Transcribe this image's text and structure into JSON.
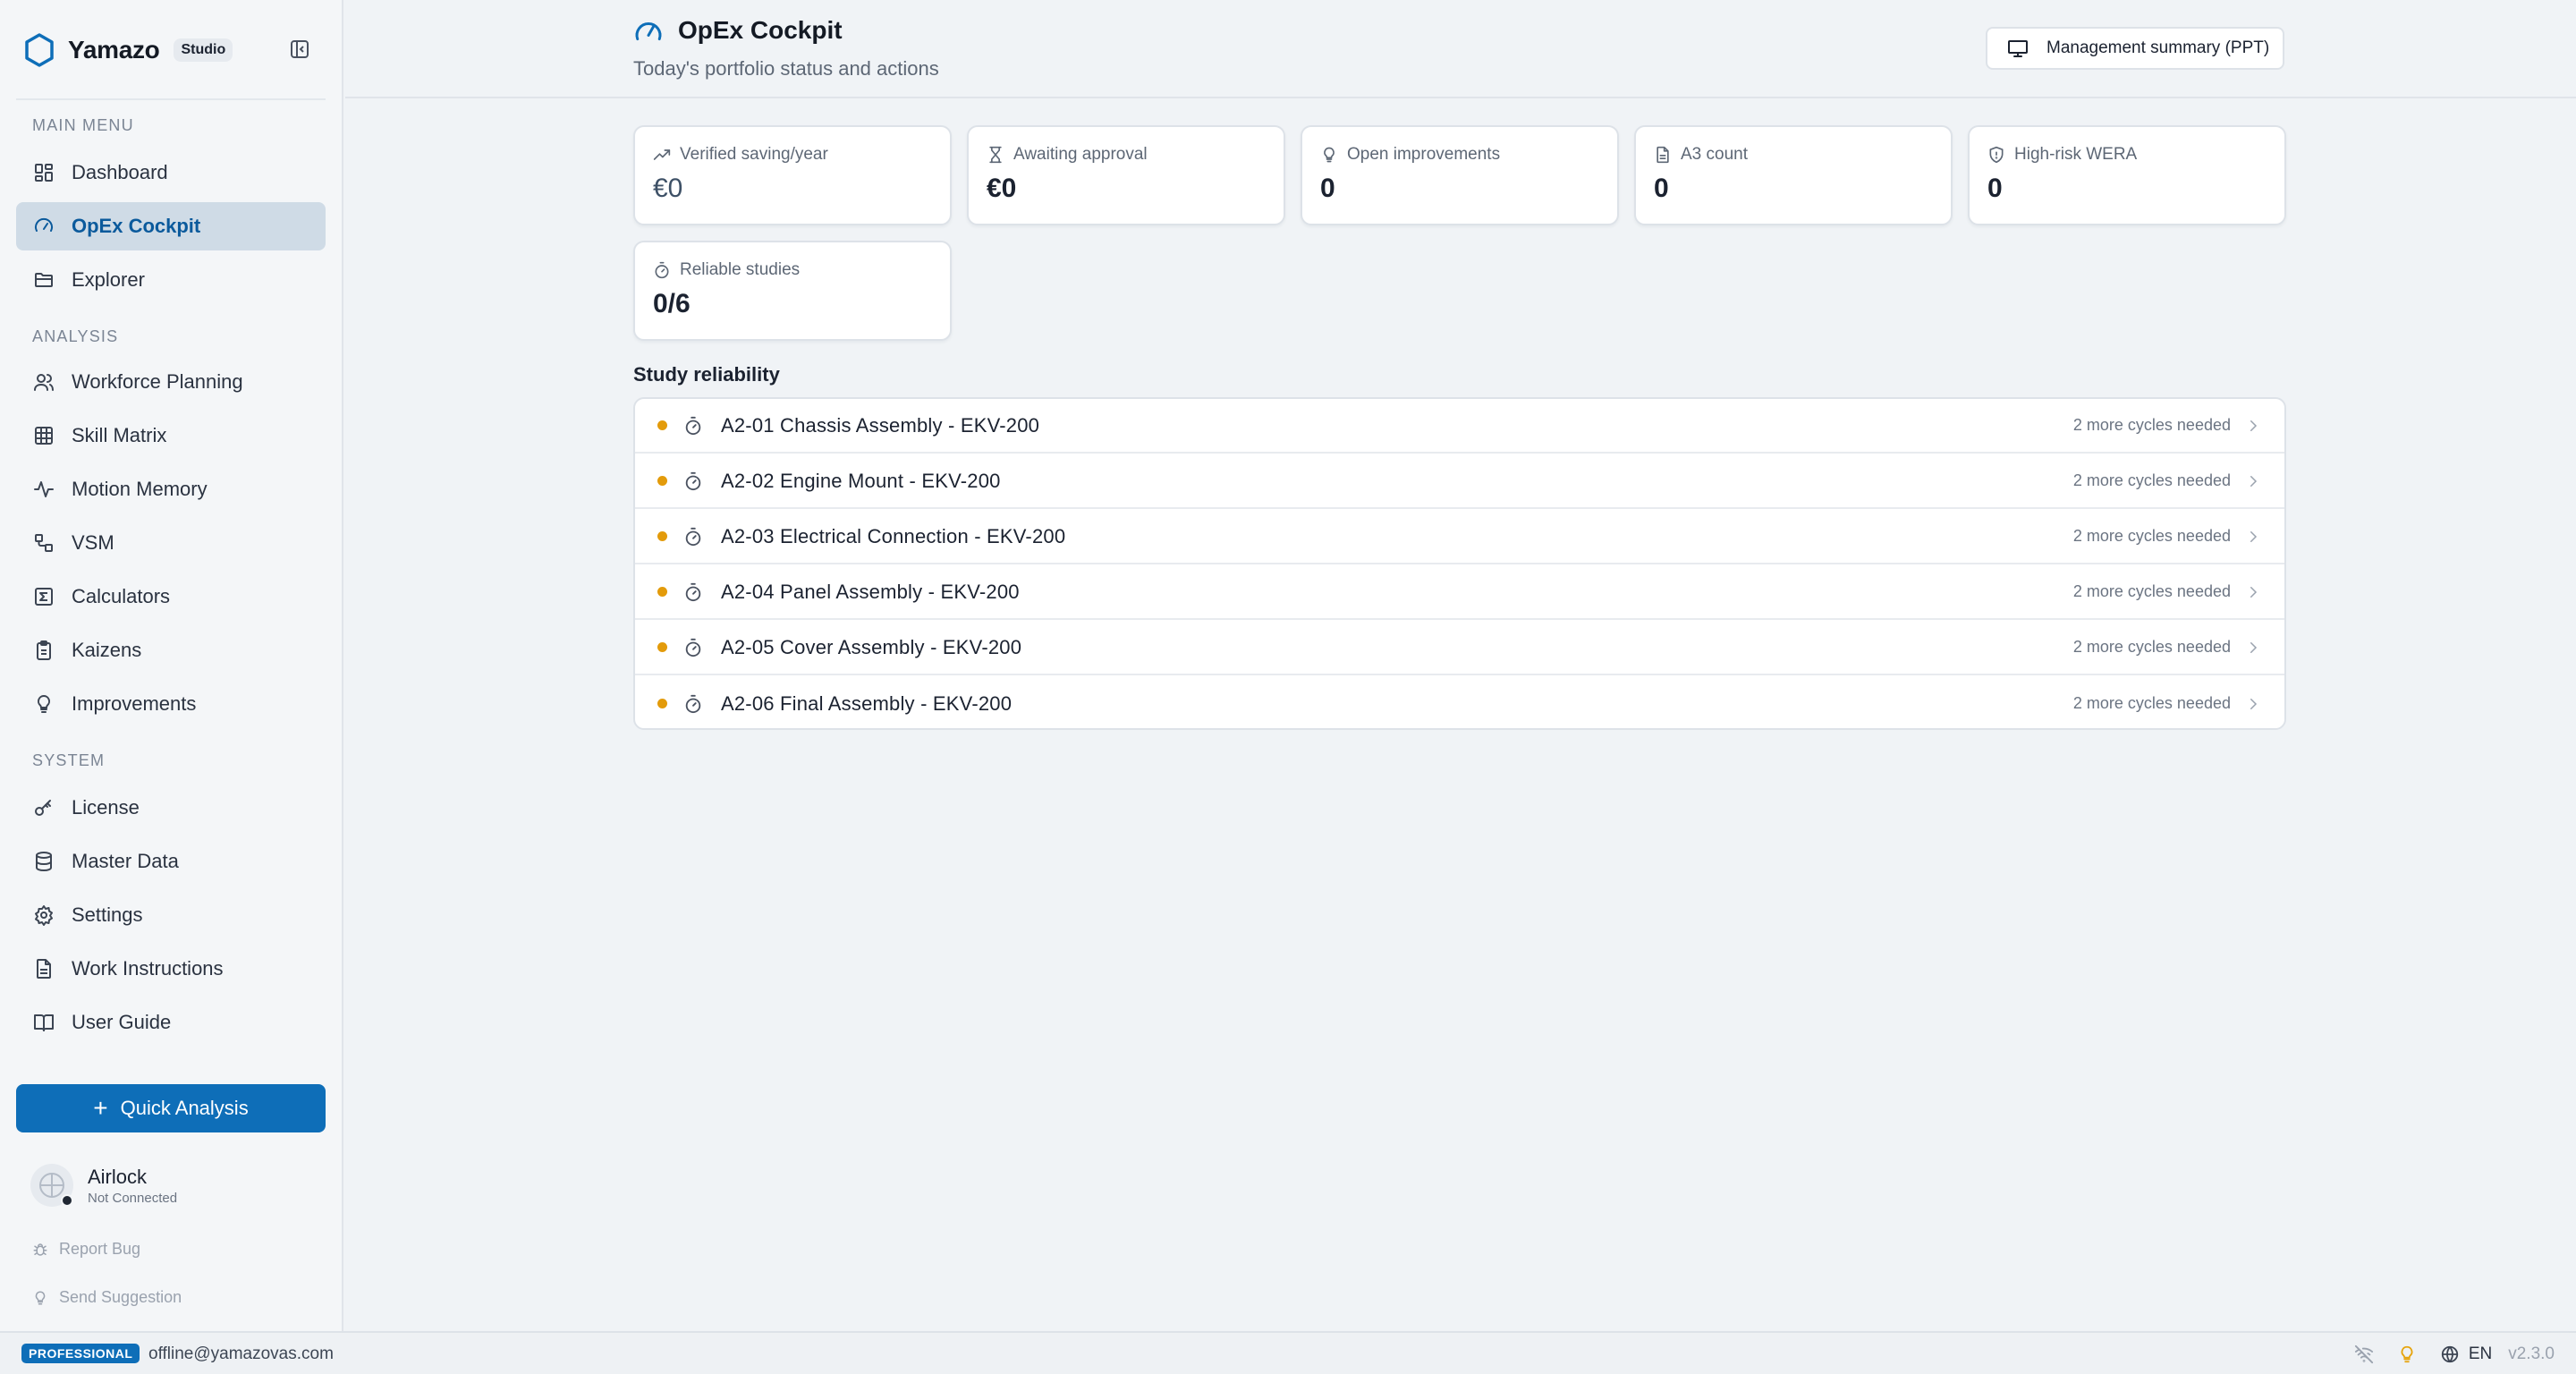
{
  "brand": {
    "name": "Yamazo",
    "badge": "Studio"
  },
  "sidebar": {
    "sections": {
      "main": "MAIN MENU",
      "analysis": "ANALYSIS",
      "system": "SYSTEM"
    },
    "main_items": [
      {
        "label": "Dashboard",
        "icon": "dashboard-icon"
      },
      {
        "label": "OpEx Cockpit",
        "icon": "gauge-icon",
        "active": true
      },
      {
        "label": "Explorer",
        "icon": "folder-icon"
      }
    ],
    "analysis_items": [
      {
        "label": "Workforce Planning",
        "icon": "users-icon"
      },
      {
        "label": "Skill Matrix",
        "icon": "grid-icon"
      },
      {
        "label": "Motion Memory",
        "icon": "activity-icon"
      },
      {
        "label": "VSM",
        "icon": "flow-icon"
      },
      {
        "label": "Calculators",
        "icon": "sigma-icon"
      },
      {
        "label": "Kaizens",
        "icon": "clipboard-icon"
      },
      {
        "label": "Improvements",
        "icon": "lightbulb-icon"
      }
    ],
    "system_items": [
      {
        "label": "License",
        "icon": "key-icon"
      },
      {
        "label": "Master Data",
        "icon": "database-icon"
      },
      {
        "label": "Settings",
        "icon": "gear-icon"
      },
      {
        "label": "Work Instructions",
        "icon": "document-icon"
      },
      {
        "label": "User Guide",
        "icon": "book-icon"
      }
    ],
    "quick_button": "Quick Analysis",
    "airlock": {
      "name": "Airlock",
      "status": "Not Connected"
    },
    "report_bug": "Report Bug",
    "send_suggestion": "Send Suggestion"
  },
  "header": {
    "title": "OpEx Cockpit",
    "subtitle": "Today's portfolio status and actions",
    "ppt_button": "Management summary (PPT)"
  },
  "kpis": [
    {
      "label": "Verified saving/year",
      "value": "€0",
      "icon": "trend-up-icon"
    },
    {
      "label": "Awaiting approval",
      "value": "€0",
      "icon": "hourglass-icon"
    },
    {
      "label": "Open improvements",
      "value": "0",
      "icon": "lightbulb-icon"
    },
    {
      "label": "A3 count",
      "value": "0",
      "icon": "document-icon"
    },
    {
      "label": "High-risk WERA",
      "value": "0",
      "icon": "shield-icon"
    },
    {
      "label": "Reliable studies",
      "value": "0/6",
      "icon": "timer-icon"
    }
  ],
  "study_section_title": "Study reliability",
  "studies": [
    {
      "name": "A2-01 Chassis Assembly - EKV-200",
      "status": "2 more cycles needed"
    },
    {
      "name": "A2-02 Engine Mount - EKV-200",
      "status": "2 more cycles needed"
    },
    {
      "name": "A2-03 Electrical Connection - EKV-200",
      "status": "2 more cycles needed"
    },
    {
      "name": "A2-04 Panel Assembly - EKV-200",
      "status": "2 more cycles needed"
    },
    {
      "name": "A2-05 Cover Assembly - EKV-200",
      "status": "2 more cycles needed"
    },
    {
      "name": "A2-06 Final Assembly - EKV-200",
      "status": "2 more cycles needed"
    }
  ],
  "footer": {
    "plan": "PROFESSIONAL",
    "email": "offline@yamazovas.com",
    "language": "EN",
    "version": "v2.3.0"
  },
  "colors": {
    "accent": "#0e6eb8",
    "warning_dot": "#e39b0b",
    "lightbulb": "#e6a40c"
  }
}
